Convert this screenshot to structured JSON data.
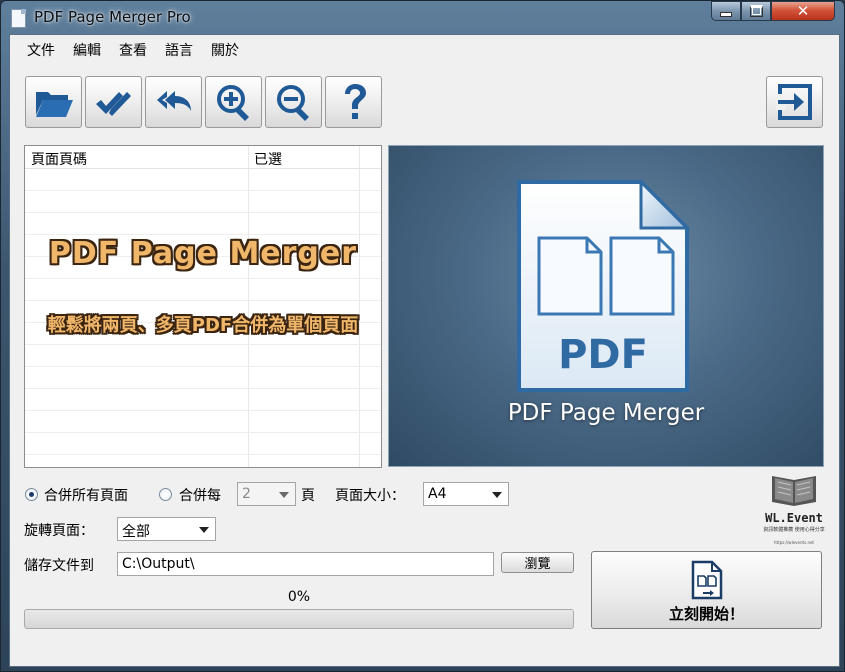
{
  "window": {
    "title": "PDF Page Merger Pro",
    "controls": {
      "minimize": "",
      "maximize": "",
      "close": "✕"
    }
  },
  "menu": [
    "文件",
    "編輯",
    "查看",
    "語言",
    "關於"
  ],
  "toolbar": {
    "icons": [
      "folder-open-icon",
      "check-all-icon",
      "undo-all-icon",
      "zoom-in-icon",
      "zoom-out-icon",
      "help-icon",
      "exit-icon"
    ]
  },
  "page_list": {
    "columns": [
      "頁面頁碼",
      "已選"
    ],
    "overlay_title": "PDF Page Merger",
    "overlay_subtitle": "輕鬆將兩頁、多頁PDF合併為單個頁面"
  },
  "preview": {
    "badge": "PDF",
    "caption": "PDF Page Merger"
  },
  "options": {
    "merge_all_label": "合併所有頁面",
    "merge_every_label": "合併每",
    "merge_every_value": "2",
    "pages_unit": "頁",
    "page_size_label": "頁面大小：",
    "page_size_value": "A4",
    "rotate_label": "旋轉頁面：",
    "rotate_value": "全部",
    "save_to_label": "儲存文件到",
    "save_path": "C:\\Output\\",
    "browse_label": "瀏覽"
  },
  "progress": {
    "text": "0%",
    "value": 0
  },
  "start_button": {
    "label": "立刻開始！"
  },
  "watermark": {
    "brand": "WL.Event",
    "tagline": "資訊軟體推薦 使用心得分享",
    "url": "https://wlevents.net"
  },
  "colors": {
    "progress_fill": "#3fb34f",
    "accent_blue": "#1f5a96",
    "overlay_text": "#f0b66a"
  }
}
